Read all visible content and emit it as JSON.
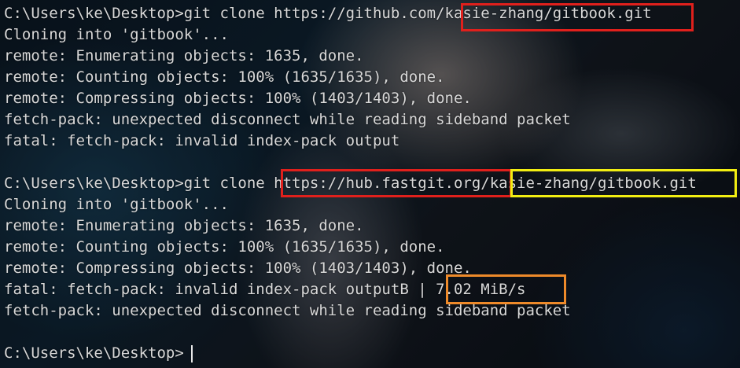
{
  "terminal": {
    "lines": [
      "C:\\Users\\ke\\Desktop>git clone https://github.com/kasie-zhang/gitbook.git",
      "Cloning into 'gitbook'...",
      "remote: Enumerating objects: 1635, done.",
      "remote: Counting objects: 100% (1635/1635), done.",
      "remote: Compressing objects: 100% (1403/1403), done.",
      "fetch-pack: unexpected disconnect while reading sideband packet",
      "fatal: fetch-pack: invalid index-pack output",
      "",
      "C:\\Users\\ke\\Desktop>git clone https://hub.fastgit.org/kasie-zhang/gitbook.git",
      "Cloning into 'gitbook'...",
      "remote: Enumerating objects: 1635, done.",
      "remote: Counting objects: 100% (1635/1635), done.",
      "remote: Compressing objects: 100% (1403/1403), done.",
      "fatal: fetch-pack: invalid index-pack outputB | 7.02 MiB/s",
      "fetch-pack: unexpected disconnect while reading sideband packet",
      "",
      "C:\\Users\\ke\\Desktop>"
    ],
    "highlights": {
      "github_repo_path": "kasie-zhang/gitbook.git",
      "fastgit_host": "https://hub.fastgit.org/",
      "fastgit_repo_path": "kasie-zhang/gitbook.git",
      "transfer_speed": "7.02 MiB/s"
    }
  },
  "colors": {
    "text": "#d8d8d8",
    "highlight_red": "#e0201c",
    "highlight_yellow": "#f2ee12",
    "highlight_orange": "#ee8a2a"
  }
}
